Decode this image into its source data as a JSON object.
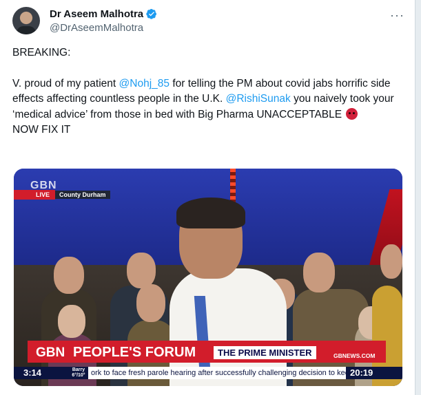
{
  "author": {
    "name": "Dr Aseem Malhotra",
    "handle": "@DrAseemMalhotra"
  },
  "post": {
    "line1": "BREAKING:",
    "line2_a": "V. proud of my patient ",
    "mention1": "@Nohj_85",
    "line2_b": " for telling the PM about covid jabs horrific side effects affecting countless people in the U.K. ",
    "mention2": "@RishiSunak",
    "line2_c": " you naively took your ‘medical advice’ from those in bed with Big Pharma UNACCEPTABLE",
    "line3": "NOW FIX IT",
    "emoji": "angry-face-emoji"
  },
  "more_label": "···",
  "video": {
    "corner_logo": "GBN",
    "live_label": "LIVE",
    "location": "County Durham",
    "banner_logo": "GBN",
    "banner_title": "PEOPLE'S FORUM",
    "banner_subtitle": "THE PRIME MINISTER",
    "banner_url": "GBNEWS.COM",
    "duration": "3:14",
    "ticker_location": "Barry 6°/10°",
    "ticker_text": "ork to face fresh parole hearing after successfully challenging decision to keep",
    "clock": "20:19"
  },
  "colors": {
    "link": "#1d9bf0",
    "verified": "#1d9bf0",
    "gb_red": "#d21d2b"
  }
}
